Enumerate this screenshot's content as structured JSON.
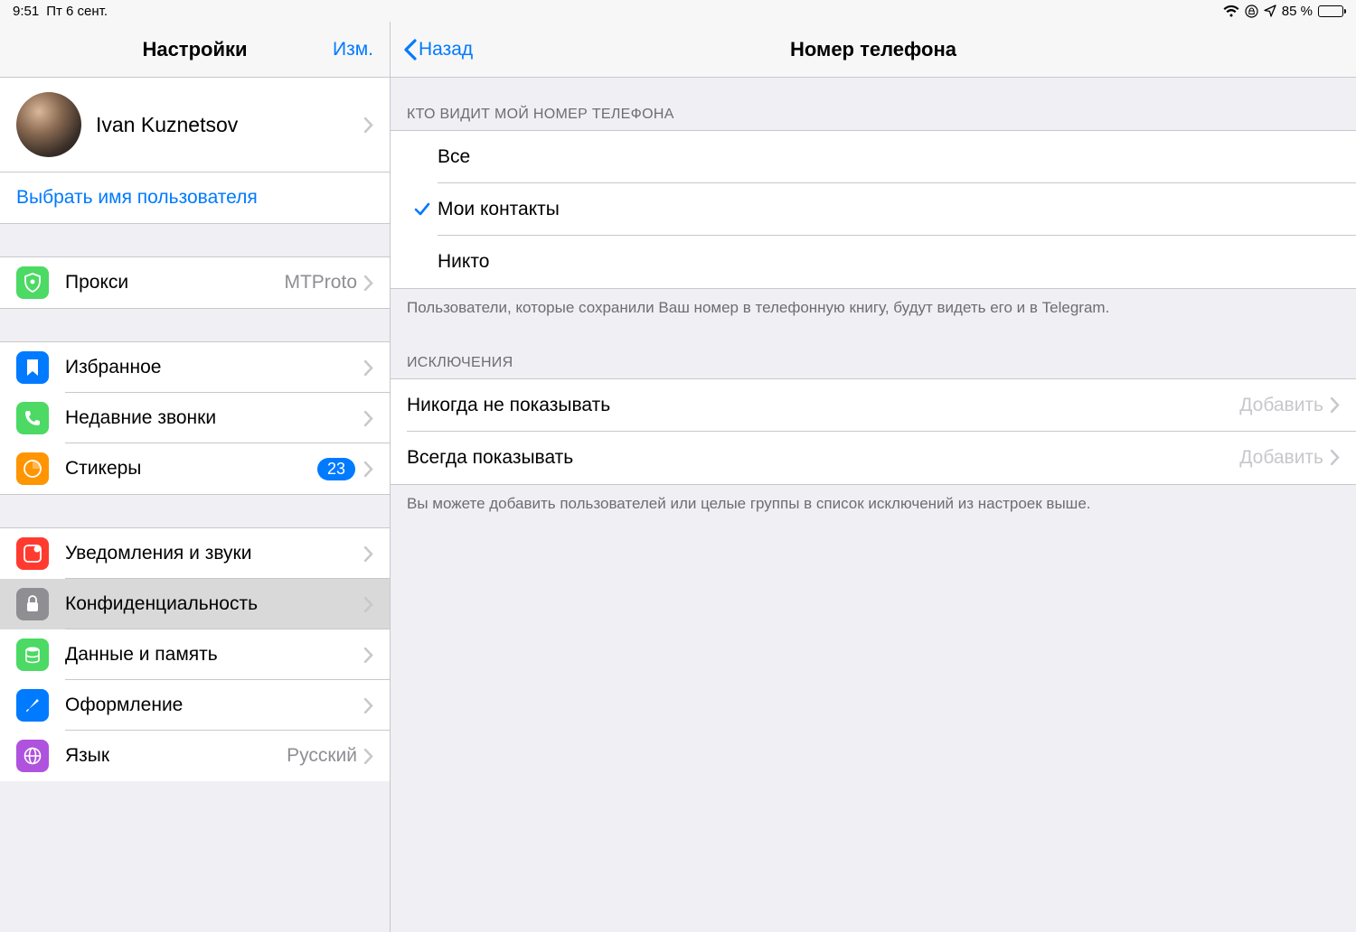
{
  "statusbar": {
    "time": "9:51",
    "date": "Пт 6 сент.",
    "battery_pct": "85 %"
  },
  "sidebar": {
    "title": "Настройки",
    "edit": "Изм.",
    "profile_name": "Ivan Kuznetsov",
    "username_link": "Выбрать имя пользователя",
    "proxy": {
      "label": "Прокси",
      "value": "MTProto"
    },
    "items": {
      "favorites": "Избранное",
      "recent_calls": "Недавние звонки",
      "stickers": {
        "label": "Стикеры",
        "badge": "23"
      },
      "notifications": "Уведомления и звуки",
      "privacy": "Конфиденциальность",
      "data": "Данные и память",
      "appearance": "Оформление",
      "language": {
        "label": "Язык",
        "value": "Русский"
      }
    }
  },
  "detail": {
    "back": "Назад",
    "title": "Номер телефона",
    "section1_header": "КТО ВИДИТ МОЙ НОМЕР ТЕЛЕФОНА",
    "options": {
      "everybody": "Все",
      "contacts": "Мои контакты",
      "nobody": "Никто"
    },
    "section1_footer": "Пользователи, которые сохранили Ваш номер в телефонную книгу, будут видеть его и в Telegram.",
    "section2_header": "ИСКЛЮЧЕНИЯ",
    "never_show": {
      "label": "Никогда не показывать",
      "value": "Добавить"
    },
    "always_show": {
      "label": "Всегда показывать",
      "value": "Добавить"
    },
    "section2_footer": "Вы можете добавить пользователей или целые группы в список исключений из настроек выше."
  }
}
